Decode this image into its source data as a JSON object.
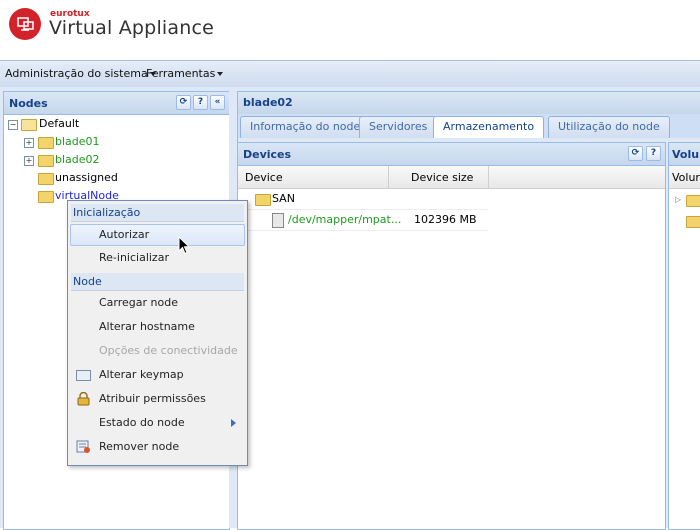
{
  "header": {
    "brand_small": "eurotux",
    "brand_title": "Virtual Appliance",
    "accent": "#d2232a"
  },
  "menubar": {
    "items": [
      {
        "label": "Administração do sistema"
      },
      {
        "label": "Ferramentas"
      }
    ]
  },
  "nodes_panel": {
    "title": "Nodes",
    "tools": [
      "refresh-icon",
      "help-icon",
      "collapse-icon"
    ],
    "tree": {
      "root": "Default",
      "children": [
        {
          "label": "blade01",
          "expandable": true,
          "color": "#1c9a1c"
        },
        {
          "label": "blade02",
          "expandable": true,
          "color": "#1c9a1c"
        },
        {
          "label": "unassigned",
          "expandable": false,
          "color": "#000000"
        },
        {
          "label": "virtualNode",
          "expandable": false,
          "color": "#2222dd"
        }
      ]
    }
  },
  "main": {
    "title": "blade02",
    "tabs": [
      {
        "label": "Informação do node"
      },
      {
        "label": "Servidores"
      },
      {
        "label": "Armazenamento",
        "active": true
      },
      {
        "label": "Utilização do node"
      }
    ],
    "devices": {
      "title": "Devices",
      "columns": [
        "Device",
        "Device size"
      ],
      "rows": [
        {
          "device": "SAN",
          "size": ""
        },
        {
          "device": "/dev/mapper/mpat...",
          "size": "102396 MB"
        }
      ]
    },
    "volumes": {
      "title": "Volur",
      "column": "Volur"
    }
  },
  "context_menu": {
    "sections": [
      {
        "title": "Inicialização",
        "items": [
          {
            "label": "Autorizar",
            "hover": true
          },
          {
            "label": "Re-inicializar"
          }
        ]
      },
      {
        "title": "Node",
        "items": [
          {
            "label": "Carregar node"
          },
          {
            "label": "Alterar hostname"
          },
          {
            "label": "Opções de conectividade",
            "disabled": true
          },
          {
            "label": "Alterar keymap",
            "icon": "keyboard-icon"
          },
          {
            "label": "Atribuir permissões",
            "icon": "lock-icon"
          },
          {
            "label": "Estado do node",
            "submenu": true
          },
          {
            "label": "Remover node",
            "icon": "remove-node-icon"
          }
        ]
      }
    ]
  }
}
